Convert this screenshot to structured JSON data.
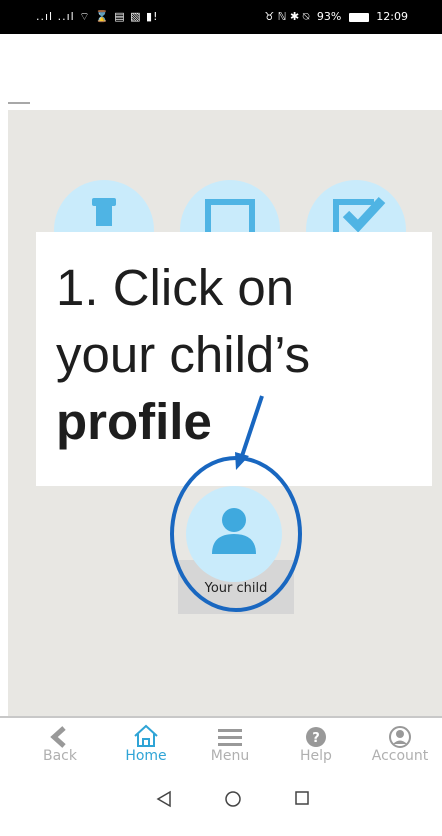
{
  "status_bar": {
    "left_icons": "..ıl ..ıl ⌔ ⌛ ▤ ▧ ▮!",
    "right_icons": "♉ ℕ ✱ ⍉",
    "battery": "93%",
    "time": "12:09"
  },
  "callout": {
    "line1": "1. Click on",
    "line2": "your child’s",
    "line3_bold": "profile"
  },
  "profile": {
    "label": "Your child"
  },
  "bottom_nav": {
    "items": [
      {
        "label": "Back",
        "icon": "chevron-left-icon"
      },
      {
        "label": "Home",
        "icon": "home-icon",
        "active": true
      },
      {
        "label": "Menu",
        "icon": "hamburger-menu-icon"
      },
      {
        "label": "Help",
        "icon": "question-circle-icon"
      },
      {
        "label": "Account",
        "icon": "user-circle-icon"
      }
    ]
  },
  "colors": {
    "accent": "#2fa4d6",
    "icon_circle": "#c9ebfb",
    "highlight": "#1967c0",
    "app_background": "#e8e7e3"
  }
}
